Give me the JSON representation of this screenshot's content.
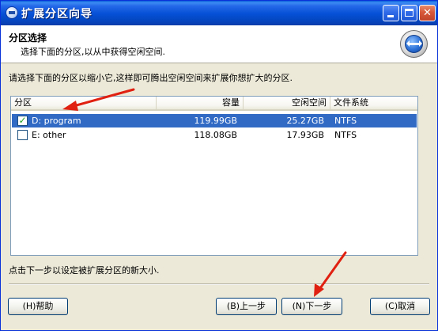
{
  "window": {
    "title": "扩展分区向导",
    "icon": "wizard-app-icon"
  },
  "header": {
    "title": "分区选择",
    "subtitle": "选择下面的分区,以从中获得空闲空间.",
    "icon": "partition-resize-icon"
  },
  "instruction": "请选择下面的分区以缩小它,这样即可腾出空闲空间来扩展你想扩大的分区.",
  "table": {
    "columns": [
      "分区",
      "容量",
      "空闲空间",
      "文件系统"
    ],
    "rows": [
      {
        "name": "D: program",
        "capacity": "119.99GB",
        "free": "25.27GB",
        "fs": "NTFS",
        "checked": true,
        "selected": true
      },
      {
        "name": "E: other",
        "capacity": "118.08GB",
        "free": "17.93GB",
        "fs": "NTFS",
        "checked": false,
        "selected": false
      }
    ]
  },
  "footer_note": "点击下一步以设定被扩展分区的新大小.",
  "buttons": {
    "help": "(H)帮助",
    "back": "(B)上一步",
    "next": "(N)下一步",
    "cancel": "(C)取消"
  },
  "colors": {
    "titlebar": "#0550D6",
    "selection": "#316AC5",
    "annotation_arrow": "#E02010"
  }
}
